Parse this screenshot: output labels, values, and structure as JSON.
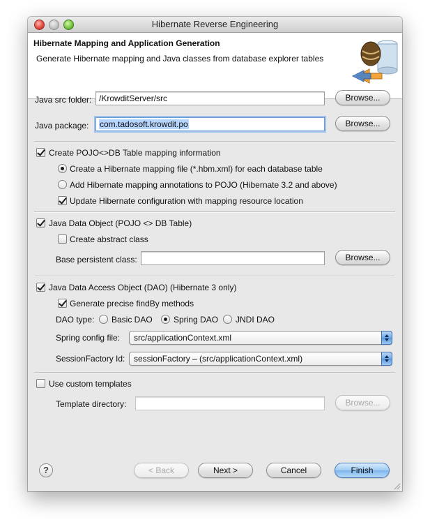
{
  "window": {
    "title": "Hibernate Reverse Engineering"
  },
  "header": {
    "title": "Hibernate Mapping and Application Generation",
    "subtitle": "Generate Hibernate mapping and Java classes from database explorer tables"
  },
  "java_src": {
    "label": "Java src folder:",
    "value": "/KrowditServer/src",
    "browse": "Browse..."
  },
  "java_package": {
    "label": "Java package:",
    "value": "com.tadosoft.krowdit.po",
    "browse": "Browse..."
  },
  "pojo_mapping": {
    "label": "Create POJO<>DB Table mapping information",
    "checked": true,
    "opt_hbm": "Create a Hibernate mapping file (*.hbm.xml) for each database table",
    "opt_annotations": "Add Hibernate mapping annotations to POJO (Hibernate 3.2 and above)",
    "update_config": "Update Hibernate configuration with mapping resource location"
  },
  "java_data_object": {
    "label": "Java Data Object (POJO <> DB Table)",
    "abstract_class": "Create abstract class",
    "base_label": "Base persistent class:",
    "base_value": "",
    "browse": "Browse..."
  },
  "dao": {
    "label": "Java Data Access Object (DAO) (Hibernate 3 only)",
    "findby": "Generate precise findBy methods",
    "type_label": "DAO type:",
    "type_basic": "Basic DAO",
    "type_spring": "Spring DAO",
    "type_jndi": "JNDI DAO",
    "spring_label": "Spring config file:",
    "spring_value": "src/applicationContext.xml",
    "session_label": "SessionFactory Id:",
    "session_value": "sessionFactory – (src/applicationContext.xml)"
  },
  "templates": {
    "label": "Use custom templates",
    "dir_label": "Template directory:",
    "dir_value": "",
    "browse": "Browse..."
  },
  "footer": {
    "help": "?",
    "back": "< Back",
    "next": "Next >",
    "cancel": "Cancel",
    "finish": "Finish"
  },
  "colors": {
    "default_button": "#8fc2f0",
    "focus_ring": "#9fc2ec",
    "selection": "#b5d5ff"
  }
}
